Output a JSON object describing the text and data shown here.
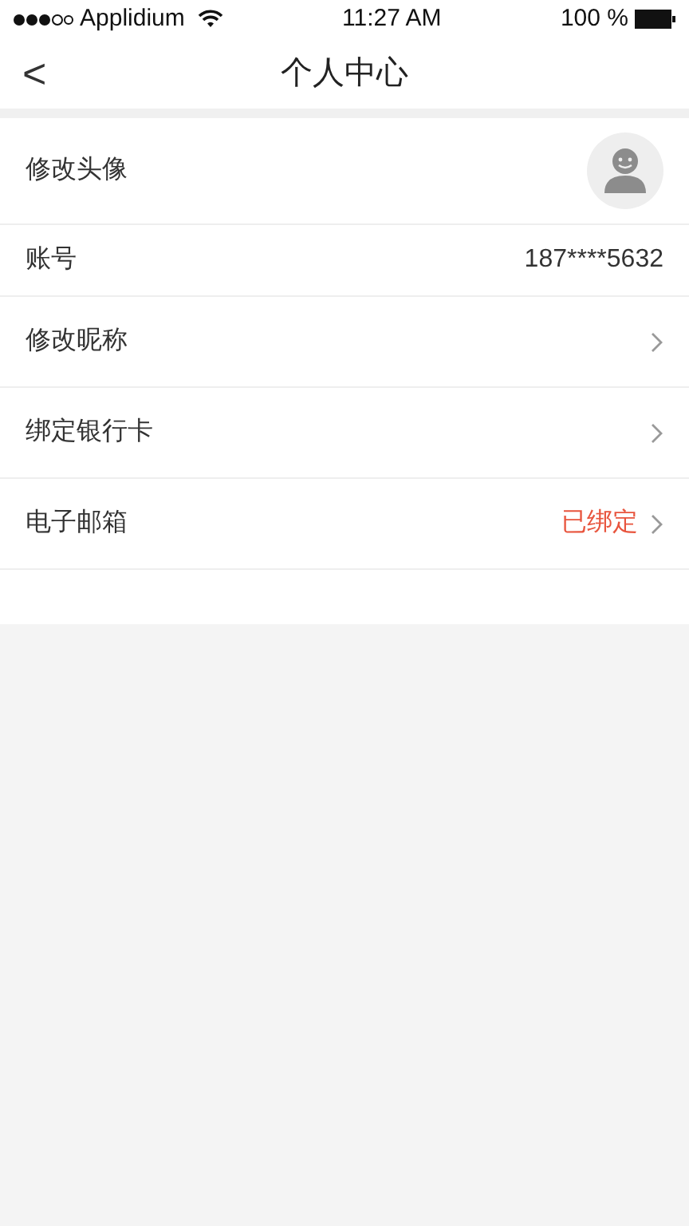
{
  "status_bar": {
    "carrier": "Applidium",
    "time": "11:27 AM",
    "battery": "100 %"
  },
  "nav_bar": {
    "back": "<",
    "title": "个人中心"
  },
  "rows": [
    {
      "kind": "avatar",
      "label": "修改头像"
    },
    {
      "kind": "value",
      "label": "账号",
      "value": "187****5632"
    },
    {
      "kind": "link",
      "label": "修改昵称"
    },
    {
      "kind": "link",
      "label": "绑定银行卡"
    },
    {
      "kind": "link",
      "label": "电子邮箱",
      "value": "已绑定"
    }
  ]
}
